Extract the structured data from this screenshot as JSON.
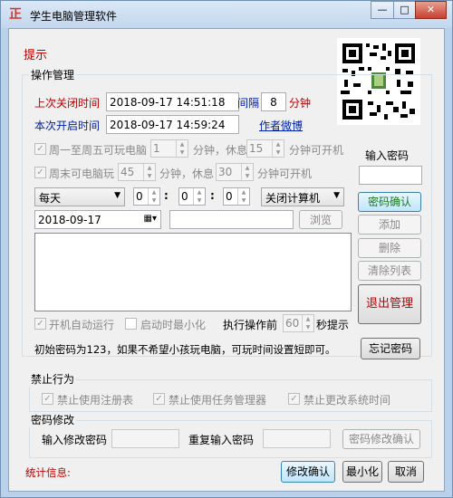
{
  "window": {
    "title": "学生电脑管理软件",
    "minimize": "—",
    "maximize": "□",
    "close": "✕",
    "icon_glyph": "正"
  },
  "header": {
    "hint": "提示"
  },
  "ops": {
    "title": "操作管理",
    "last_close_label": "上次关闭时间",
    "last_close_value": "2018-09-17 14:51:18",
    "interval_label": "间隔",
    "interval_value": "8",
    "minutes_label": "分钟",
    "open_label": "本次开启时间",
    "open_value": "2018-09-17 14:59:24",
    "weibo_link": "作者微博",
    "weekday_label": "周一至周五可玩电脑",
    "weekday_play": "1",
    "weekday_rest": "15",
    "weekend_label": "周末可电脑玩",
    "weekend_play": "45",
    "weekend_rest": "30",
    "minute_rest_label": "分钟，休息",
    "minute_open_label": "分钟可开机",
    "password_label": "输入密码",
    "password_value": "",
    "confirm_pwd": "密码确认",
    "repeat_select": "每天",
    "hour": "0",
    "minute": "0",
    "second": "0",
    "time_sep": ":",
    "action_select": "关闭计算机",
    "date_value": "2018-09-17",
    "browse": "浏览",
    "add": "添加",
    "delete": "删除",
    "clear_list": "清除列表",
    "exit_manage": "退出管理",
    "autostart": "开机自动运行",
    "minimize_on_start": "启动时最小化",
    "before_exec_label": "执行操作前",
    "before_exec_value": "60",
    "seconds_hint": "秒提示",
    "initial_pwd_note": "初始密码为123，如果不希望小孩玩电脑，可玩时间设置短即可。",
    "forgot_pwd": "忘记密码",
    "check_mark": "✓"
  },
  "forbid": {
    "title": "禁止行为",
    "registry": "禁止使用注册表",
    "taskmgr": "禁止使用任务管理器",
    "systime": "禁止更改系统时间"
  },
  "pwd_change": {
    "title": "密码修改",
    "new_label": "输入修改密码",
    "repeat_label": "重复输入密码",
    "confirm": "密码修改确认"
  },
  "footer": {
    "stats": "统计信息:",
    "modify_confirm": "修改确认",
    "minimize": "最小化",
    "cancel": "取消"
  },
  "colors": {
    "red_label": "#c00000",
    "blue_label": "#0020b0"
  }
}
